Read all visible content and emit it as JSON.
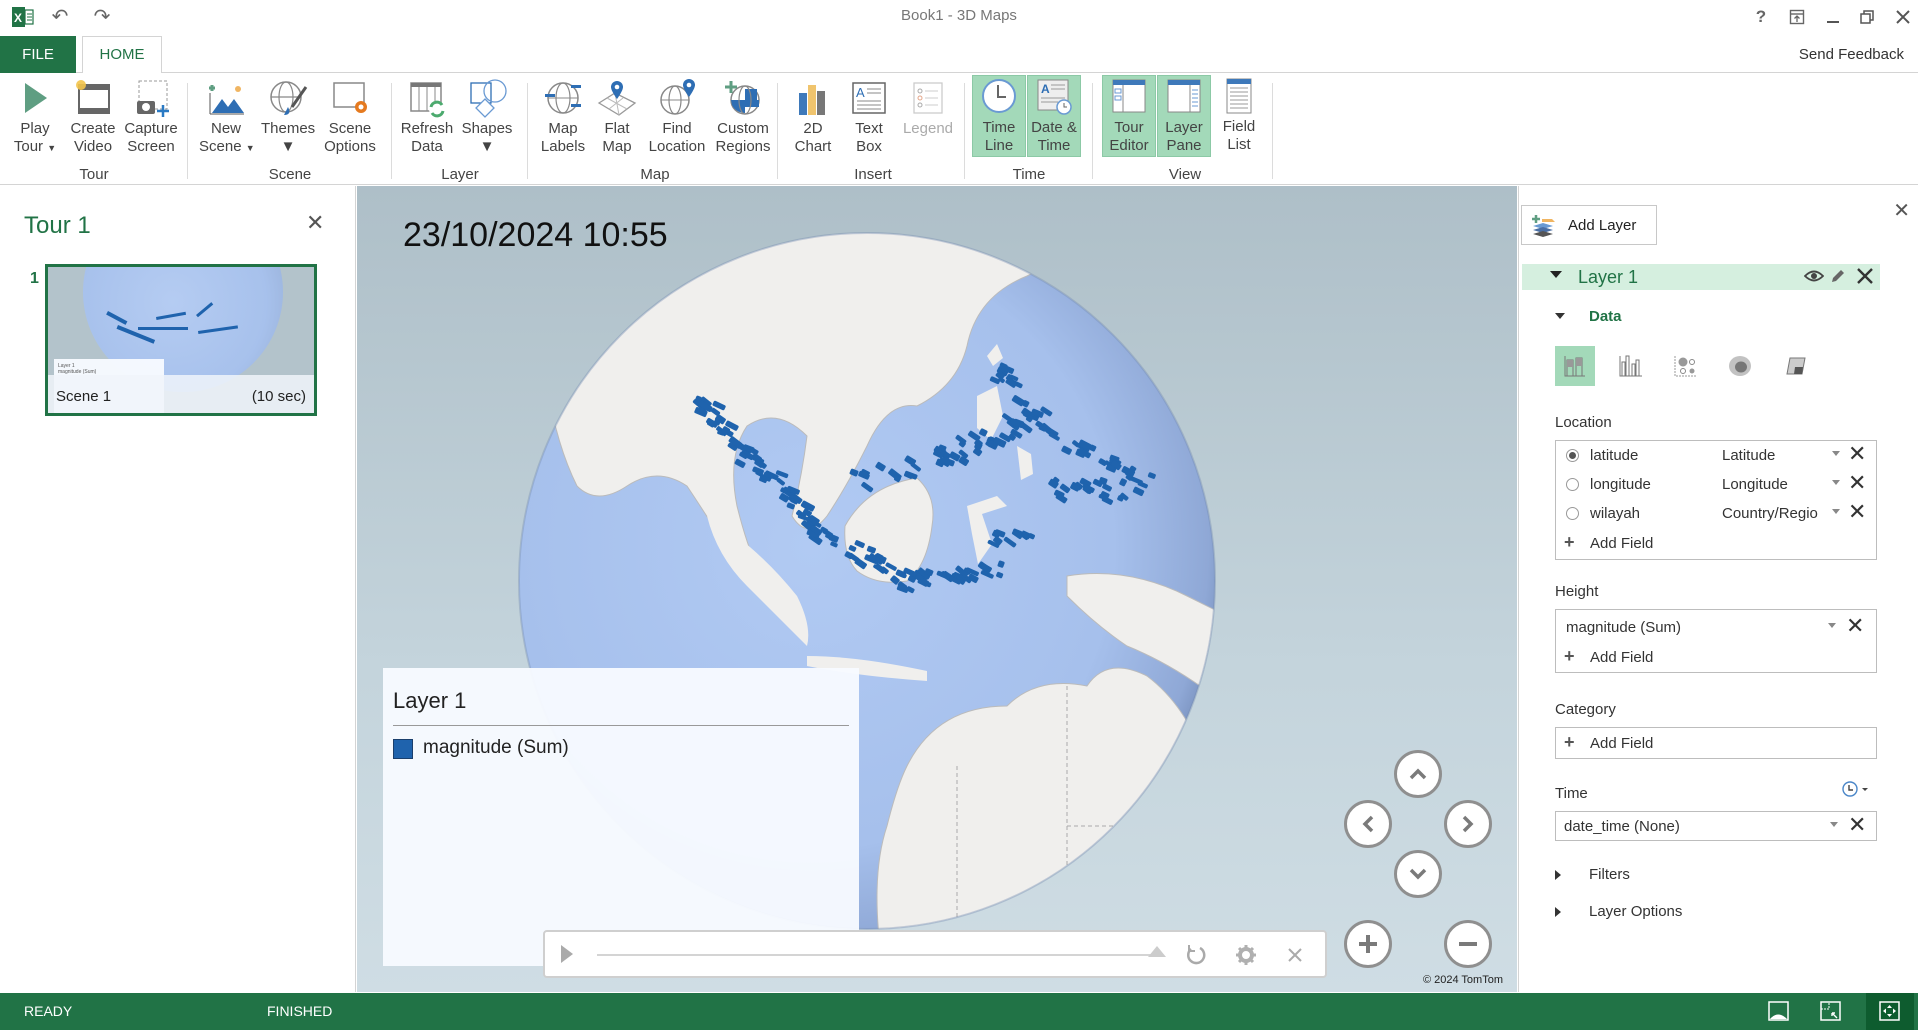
{
  "window": {
    "title": "Book1 - 3D Maps",
    "controls": [
      "help-icon",
      "ribbon-display-icon",
      "minimize-icon",
      "restore-icon",
      "close-icon"
    ]
  },
  "quick_access": [
    "excel-app-icon",
    "undo-icon",
    "redo-icon"
  ],
  "tabs": {
    "file": "FILE",
    "home": "HOME",
    "send_feedback": "Send Feedback"
  },
  "ribbon": {
    "groups": [
      {
        "label": "Tour",
        "buttons": [
          {
            "line1": "Play",
            "line2": "Tour",
            "dropdown": true,
            "icon": "play-icon"
          },
          {
            "line1": "Create",
            "line2": "Video",
            "icon": "video-icon"
          },
          {
            "line1": "Capture",
            "line2": "Screen",
            "icon": "camera-icon"
          }
        ]
      },
      {
        "label": "Scene",
        "buttons": [
          {
            "line1": "New",
            "line2": "Scene",
            "dropdown": true,
            "icon": "new-scene-icon"
          },
          {
            "line1": "Themes",
            "line2": "",
            "dropdown": true,
            "icon": "themes-icon"
          },
          {
            "line1": "Scene",
            "line2": "Options",
            "icon": "scene-options-icon"
          }
        ]
      },
      {
        "label": "Layer",
        "buttons": [
          {
            "line1": "Refresh",
            "line2": "Data",
            "icon": "refresh-data-icon"
          },
          {
            "line1": "Shapes",
            "line2": "",
            "dropdown": true,
            "icon": "shapes-icon"
          }
        ]
      },
      {
        "label": "Map",
        "buttons": [
          {
            "line1": "Map",
            "line2": "Labels",
            "icon": "map-labels-icon"
          },
          {
            "line1": "Flat",
            "line2": "Map",
            "icon": "flat-map-icon"
          },
          {
            "line1": "Find",
            "line2": "Location",
            "icon": "find-location-icon"
          },
          {
            "line1": "Custom",
            "line2": "Regions",
            "icon": "custom-regions-icon"
          }
        ]
      },
      {
        "label": "Insert",
        "buttons": [
          {
            "line1": "2D",
            "line2": "Chart",
            "icon": "chart-icon"
          },
          {
            "line1": "Text",
            "line2": "Box",
            "icon": "text-box-icon"
          },
          {
            "line1": "Legend",
            "line2": "",
            "disabled": true,
            "icon": "legend-icon"
          }
        ]
      },
      {
        "label": "Time",
        "buttons": [
          {
            "line1": "Time",
            "line2": "Line",
            "active": true,
            "icon": "clock-icon"
          },
          {
            "line1": "Date &",
            "line2": "Time",
            "active": true,
            "icon": "date-time-icon"
          }
        ]
      },
      {
        "label": "View",
        "buttons": [
          {
            "line1": "Tour",
            "line2": "Editor",
            "active": true,
            "icon": "tour-editor-icon"
          },
          {
            "line1": "Layer",
            "line2": "Pane",
            "active": true,
            "icon": "layer-pane-icon"
          },
          {
            "line1": "Field",
            "line2": "List",
            "icon": "field-list-icon"
          }
        ]
      }
    ]
  },
  "tour_pane": {
    "title": "Tour 1",
    "scenes": [
      {
        "number": "1",
        "name": "Scene 1",
        "duration": "(10 sec)",
        "legend_title": "Layer 1",
        "legend_entry": "magnitude (Sum)"
      }
    ]
  },
  "map": {
    "datetime": "23/10/2024 10:55",
    "copyright": "© 2024 TomTom",
    "colors": {
      "ocean": "#a9c3ef",
      "land": "#f0efed",
      "column": "#1f63ad",
      "background": "#b8c9d1"
    },
    "legend": {
      "title": "Layer 1",
      "entries": [
        {
          "label": "magnitude (Sum)",
          "color": "#1f63ad"
        }
      ]
    },
    "playback": {
      "progress": 1.0
    },
    "nav": [
      "tilt-up",
      "rotate-left",
      "rotate-right",
      "tilt-down",
      "zoom-in",
      "zoom-out"
    ]
  },
  "layer_pane": {
    "add_layer": "Add Layer",
    "layer": {
      "name": "Layer 1",
      "data_label": "Data",
      "viz_types": [
        {
          "name": "stacked-column",
          "selected": true
        },
        {
          "name": "clustered-column",
          "selected": false
        },
        {
          "name": "bubble",
          "selected": false
        },
        {
          "name": "heat-map",
          "selected": false
        },
        {
          "name": "region",
          "selected": false
        }
      ],
      "location": {
        "label": "Location",
        "fields": [
          {
            "name": "latitude",
            "type": "Latitude",
            "selected": true
          },
          {
            "name": "longitude",
            "type": "Longitude",
            "selected": false
          },
          {
            "name": "wilayah",
            "type": "Country/Regio",
            "selected": false
          }
        ],
        "add_field": "Add Field"
      },
      "height": {
        "label": "Height",
        "fields": [
          {
            "name": "magnitude (Sum)"
          }
        ],
        "add_field": "Add Field"
      },
      "category": {
        "label": "Category",
        "add_field": "Add Field"
      },
      "time": {
        "label": "Time",
        "field": "date_time (None)"
      },
      "filters": "Filters",
      "layer_options": "Layer Options"
    }
  },
  "status_bar": {
    "left": "READY",
    "middle": "FINISHED",
    "view_icons": [
      {
        "name": "globe-view-icon",
        "active": false
      },
      {
        "name": "screen-region-icon",
        "active": false
      },
      {
        "name": "navigation-icon",
        "active": true
      }
    ]
  }
}
